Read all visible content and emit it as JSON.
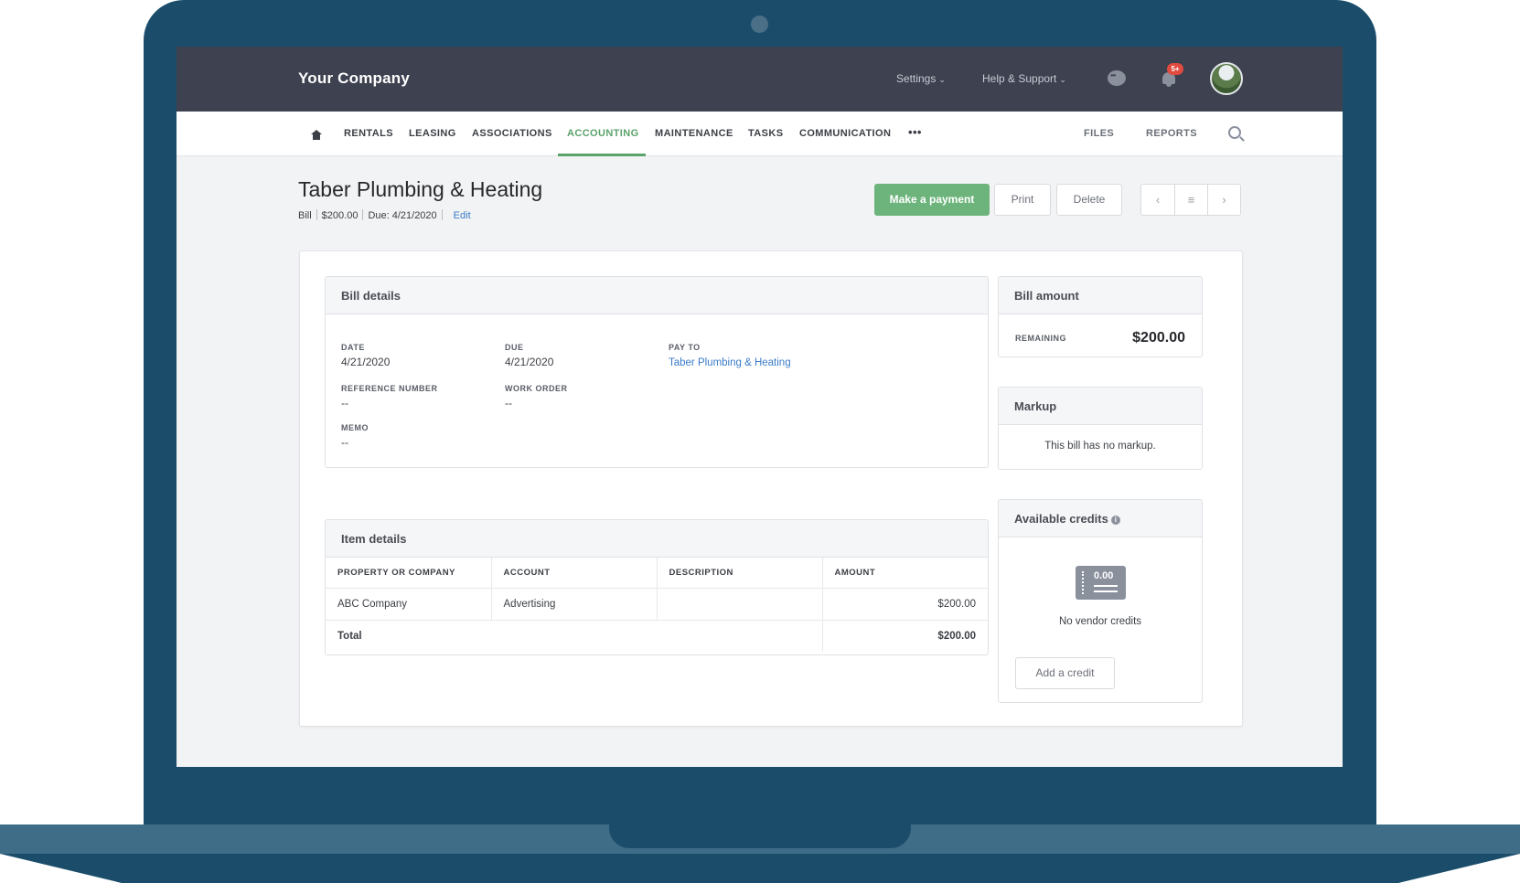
{
  "header": {
    "brand": "Your Company",
    "settings_label": "Settings",
    "help_label": "Help & Support",
    "notification_badge": "5+"
  },
  "nav": {
    "items": [
      "RENTALS",
      "LEASING",
      "ASSOCIATIONS",
      "ACCOUNTING",
      "MAINTENANCE",
      "TASKS",
      "COMMUNICATION"
    ],
    "more": "•••",
    "files": "FILES",
    "reports": "REPORTS",
    "active": "ACCOUNTING"
  },
  "page": {
    "title": "Taber Plumbing & Heating",
    "type": "Bill",
    "amount": "$200.00",
    "due": "Due: 4/21/2020",
    "edit": "Edit"
  },
  "actions": {
    "make_payment": "Make a payment",
    "print": "Print",
    "delete": "Delete",
    "prev": "‹",
    "list": "≡",
    "next": "›"
  },
  "bill_details": {
    "title": "Bill details",
    "date_label": "DATE",
    "date": "4/21/2020",
    "due_label": "DUE",
    "due": "4/21/2020",
    "pay_to_label": "PAY TO",
    "pay_to": "Taber Plumbing & Heating",
    "ref_label": "REFERENCE NUMBER",
    "ref": "--",
    "work_order_label": "WORK ORDER",
    "work_order": "--",
    "memo_label": "MEMO",
    "memo": "--"
  },
  "item_details": {
    "title": "Item details",
    "columns": [
      "PROPERTY OR COMPANY",
      "ACCOUNT",
      "DESCRIPTION",
      "AMOUNT"
    ],
    "rows": [
      {
        "property": "ABC Company",
        "account": "Advertising",
        "description": "",
        "amount": "$200.00"
      }
    ],
    "total_label": "Total",
    "total": "$200.00"
  },
  "bill_amount": {
    "title": "Bill amount",
    "remaining_label": "REMAINING",
    "remaining": "$200.00"
  },
  "markup": {
    "title": "Markup",
    "text": "This bill has no markup."
  },
  "credits": {
    "title": "Available credits",
    "info": "i",
    "icon_amount": "0.00",
    "empty_text": "No vendor credits",
    "add_button": "Add a credit"
  },
  "colors": {
    "frame": "#1b4d6b",
    "topbar": "#3d4150",
    "accent": "#5ba36a",
    "link": "#3a7bc8"
  }
}
